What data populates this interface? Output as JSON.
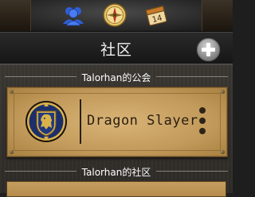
{
  "topbar": {
    "icons": [
      "friends-icon",
      "guild-compass-icon",
      "calendar-icon"
    ],
    "calendar_day": "14"
  },
  "header": {
    "title": "社区",
    "add_icon": "plus-icon"
  },
  "sections": {
    "guild_heading": "Talorhan的公会",
    "community_heading": "Talorhan的社区"
  },
  "guild_card": {
    "name": "Dragon Slayer",
    "emblem": "alliance-lion-crest-icon",
    "menu_icon": "more-vertical-icon"
  },
  "colors": {
    "parchment": "#c9a263",
    "emblem_blue": "#1c2f6b",
    "emblem_gold": "#d9b24a",
    "header_bg": "#1c1c1c",
    "content_bg": "#35322d"
  }
}
